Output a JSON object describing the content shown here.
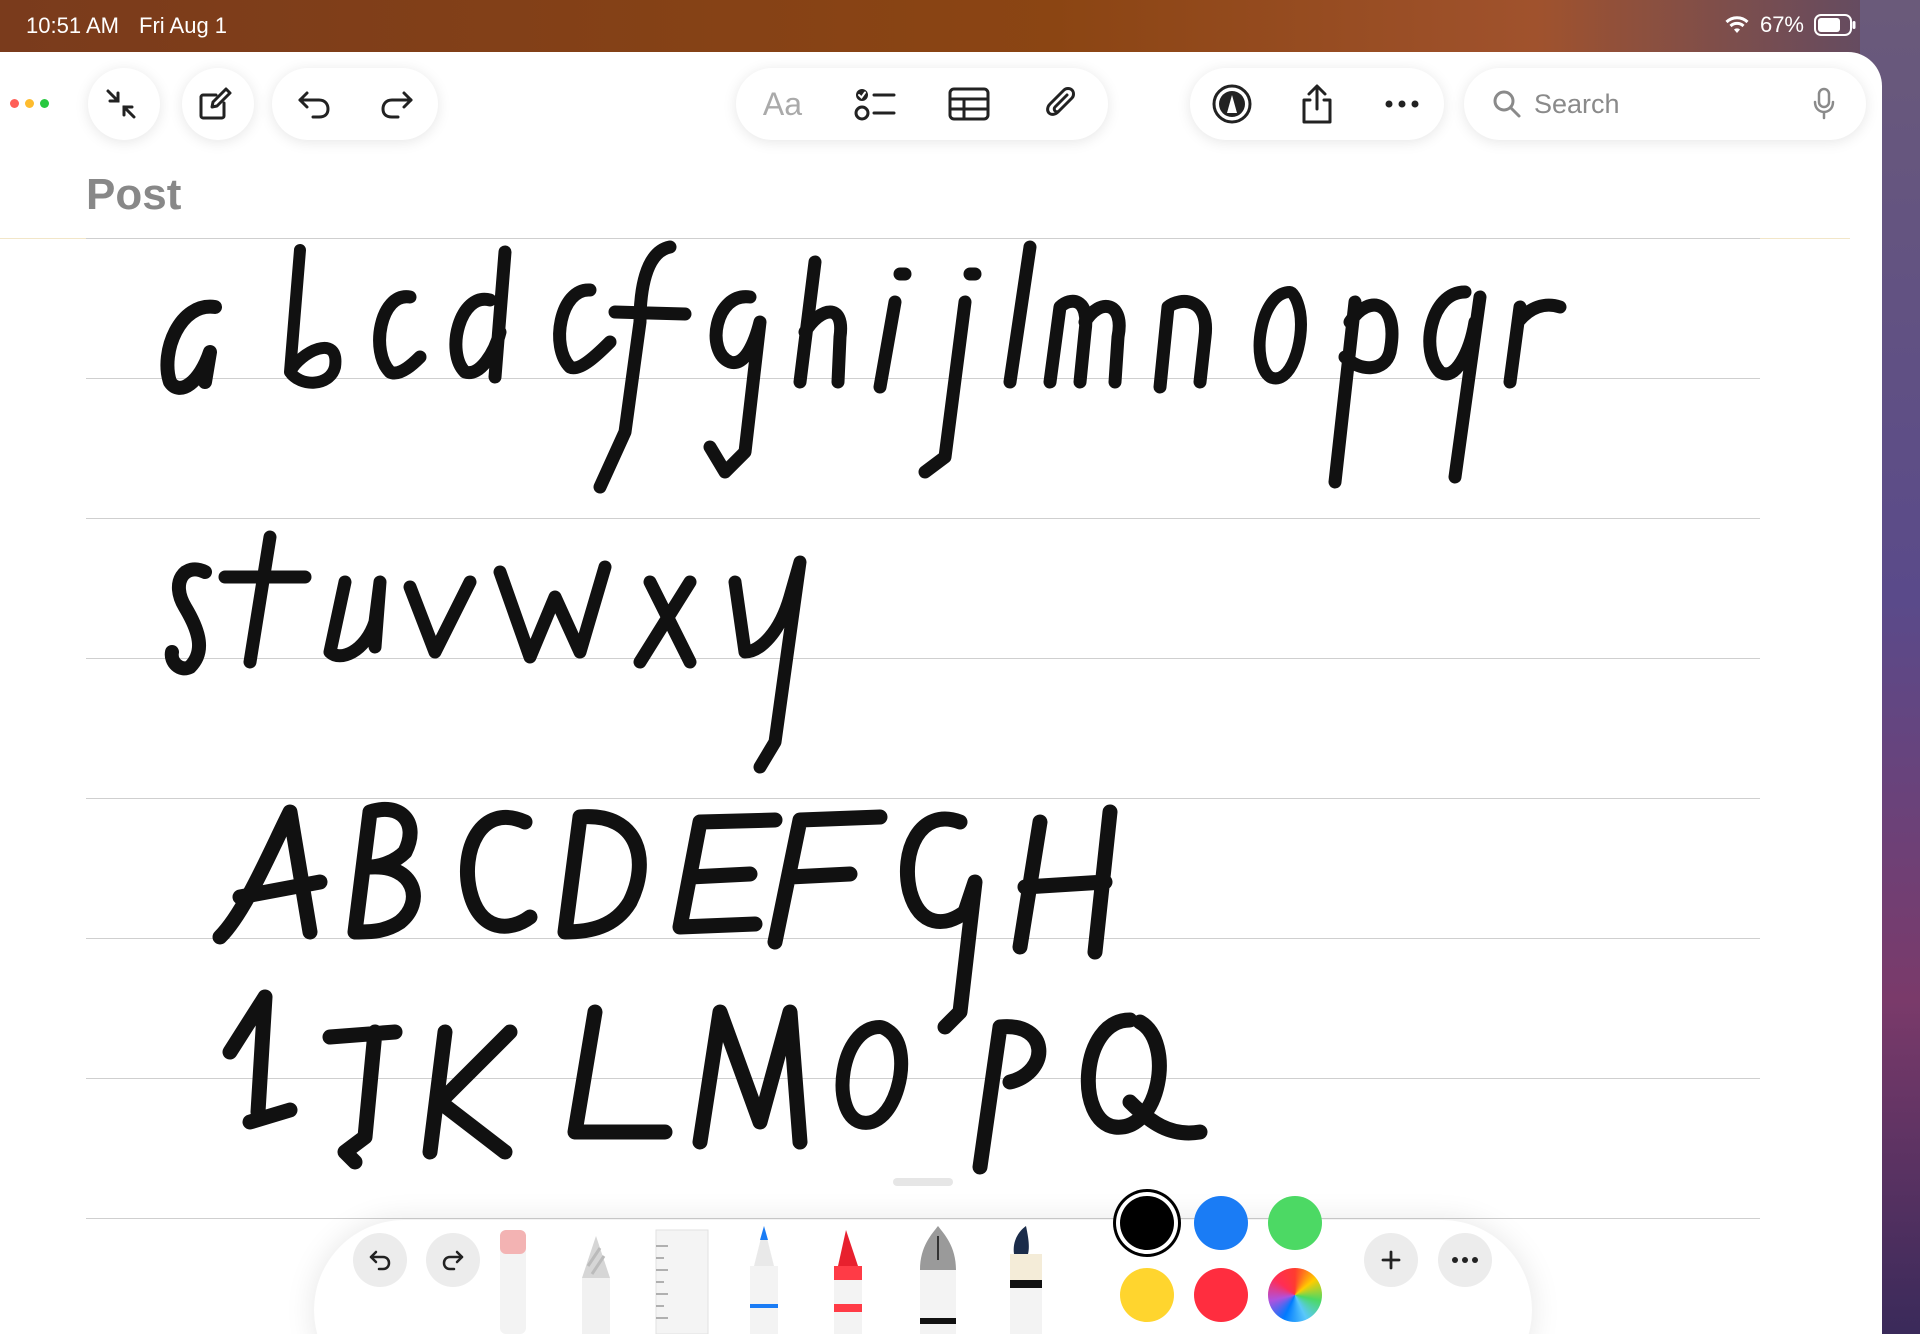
{
  "status_bar": {
    "time": "10:51 AM",
    "date": "Fri Aug 1",
    "battery": "67%",
    "icons": [
      "wifi-icon",
      "battery-icon"
    ]
  },
  "toolbar": {
    "format_label": "Aa",
    "search_placeholder": "Search",
    "icons": [
      "collapse-icon",
      "compose-icon",
      "undo-icon",
      "redo-icon",
      "checklist-icon",
      "table-icon",
      "attachment-icon",
      "markup-icon",
      "share-icon",
      "more-icon",
      "search-icon",
      "microphone-icon"
    ]
  },
  "note": {
    "title": "Post",
    "handwriting_lines": [
      "a b c d c f g h i j l m n o p q r",
      "s t u v w x y",
      "A B C D E F G H",
      "I J K L M O P Q"
    ]
  },
  "tool_palette": {
    "tools": [
      "undo",
      "redo",
      "eraser",
      "pencil",
      "ruler",
      "pen",
      "marker",
      "fountain-pen",
      "watercolor-brush"
    ],
    "colors": [
      "#000000",
      "#1a7cf5",
      "#4cd964",
      "#ffd52e",
      "#ff2d3f",
      "color-wheel"
    ],
    "selected_color": "#000000"
  }
}
